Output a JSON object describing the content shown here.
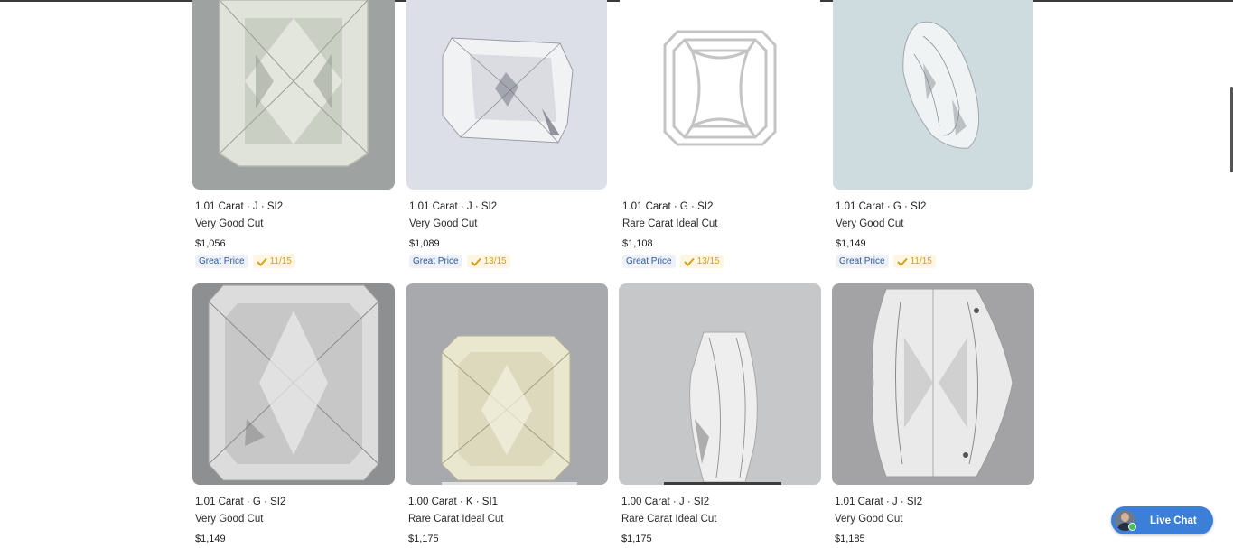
{
  "products": [
    {
      "title": "1.01 Carat · J · SI2",
      "cut": "Very Good Cut",
      "price": "$1,056",
      "badge": "Great Price",
      "score": "11/15",
      "image": "radiant-diamond-photo",
      "bg": "#9da2a2"
    },
    {
      "title": "1.01 Carat · J · SI2",
      "cut": "Very Good Cut",
      "price": "$1,089",
      "badge": "Great Price",
      "score": "13/15",
      "image": "radiant-diamond-photo",
      "bg": "#dcdfe7"
    },
    {
      "title": "1.01 Carat · G · SI2",
      "cut": "Rare Carat Ideal Cut",
      "price": "$1,108",
      "badge": "Great Price",
      "score": "13/15",
      "image": "radiant-outline-icon",
      "bg": "#ffffff"
    },
    {
      "title": "1.01 Carat · G · SI2",
      "cut": "Very Good Cut",
      "price": "$1,149",
      "badge": "Great Price",
      "score": "11/15",
      "image": "radiant-diamond-side-photo",
      "bg": "#cfdcdf"
    },
    {
      "title": "1.01 Carat · G · SI2",
      "cut": "Very Good Cut",
      "price": "$1,149",
      "image": "radiant-diamond-photo",
      "bg": "#8d8f90"
    },
    {
      "title": "1.00 Carat · K · SI1",
      "cut": "Rare Carat Ideal Cut",
      "price": "$1,175",
      "image": "radiant-diamond-photo",
      "bg": "#a7a9ad"
    },
    {
      "title": "1.00 Carat · J · SI2",
      "cut": "Rare Carat Ideal Cut",
      "price": "$1,175",
      "image": "radiant-diamond-side-photo",
      "bg": "#c6c7c9"
    },
    {
      "title": "1.01 Carat · J · SI2",
      "cut": "Very Good Cut",
      "price": "$1,185",
      "image": "radiant-diamond-side-photo",
      "bg": "#a3a3a5"
    }
  ],
  "live_chat": {
    "label": "Live Chat"
  },
  "colors": {
    "accent": "#3b7fd8",
    "badge_text": "#2c5aa0",
    "score_text": "#d7a11a"
  }
}
